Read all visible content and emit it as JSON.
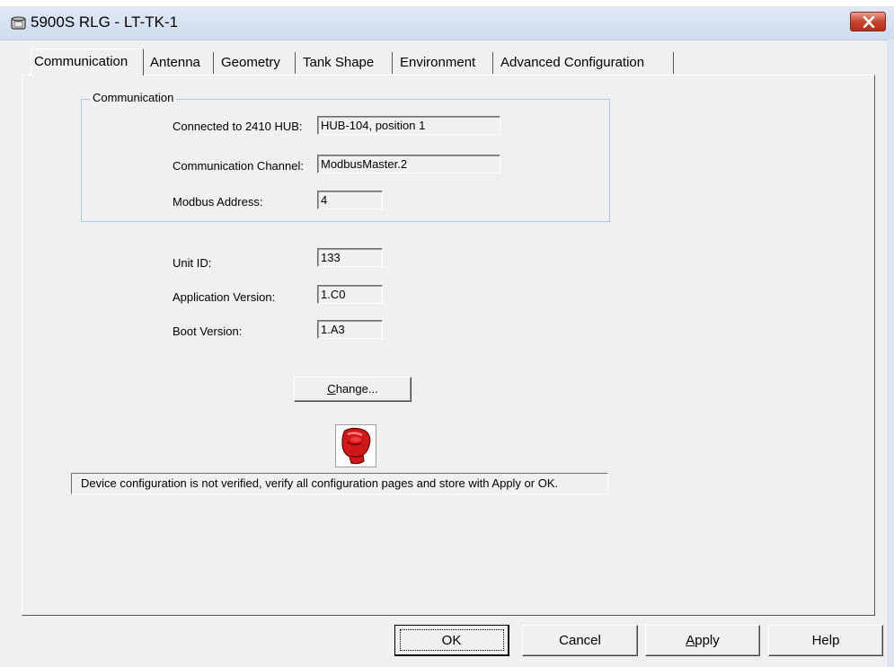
{
  "window": {
    "title": "5900S RLG  - LT-TK-1",
    "close_icon": "close-icon"
  },
  "tabs": [
    {
      "label": "Communication",
      "active": true
    },
    {
      "label": "Antenna",
      "active": false
    },
    {
      "label": "Geometry",
      "active": false
    },
    {
      "label": "Tank Shape",
      "active": false
    },
    {
      "label": "Environment",
      "active": false
    },
    {
      "label": "Advanced Configuration",
      "active": false
    }
  ],
  "communication_group": {
    "title": "Communication",
    "hub_label": "Connected to 2410 HUB:",
    "hub_value": "HUB-104, position 1",
    "channel_label": "Communication Channel:",
    "channel_value": "ModbusMaster.2",
    "modbus_label": "Modbus Address:",
    "modbus_value": "4"
  },
  "device_info": {
    "unit_id_label": "Unit ID:",
    "unit_id_value": "133",
    "app_version_label": "Application Version:",
    "app_version_value": "1.C0",
    "boot_version_label": "Boot Version:",
    "boot_version_value": "1.A3"
  },
  "change_button": {
    "accel": "C",
    "rest": "hange..."
  },
  "status": {
    "icon": "red-boxing-glove-icon",
    "message": "Device configuration is not verified, verify all configuration pages and store with Apply or OK."
  },
  "buttons": {
    "ok": "OK",
    "cancel": "Cancel",
    "apply_accel": "A",
    "apply_rest": "pply",
    "help": "Help"
  },
  "colors": {
    "close_button": "#c7452f",
    "titlebar": "#dfe9f6",
    "status_icon": "#d01818"
  }
}
